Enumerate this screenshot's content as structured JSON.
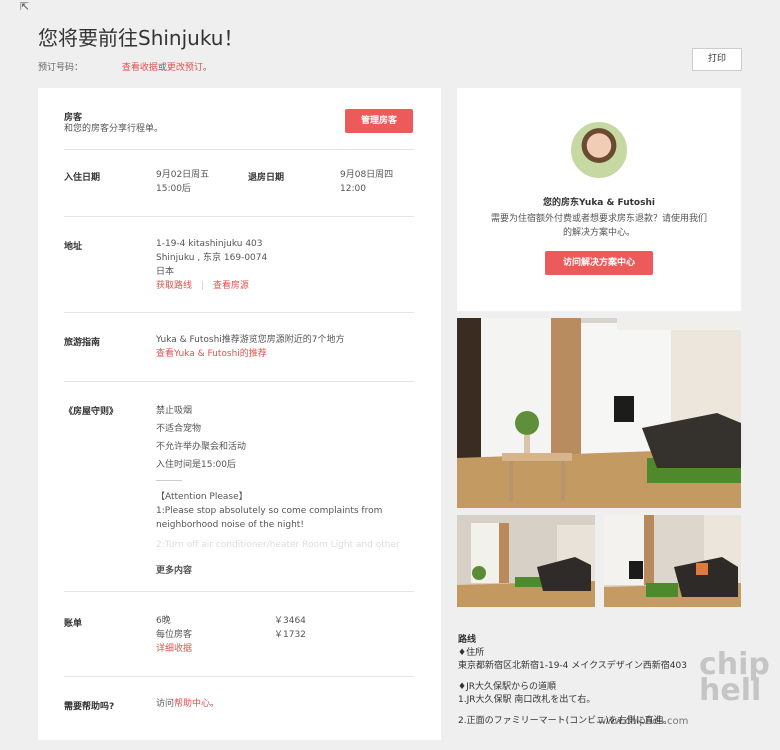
{
  "header": {
    "title": "您将要前往Shinjuku！",
    "booking_code_label": "预订号码：",
    "view_receipt": "查看收据",
    "or": "或",
    "change_booking": "更改预订",
    "period": "。",
    "print": "打印"
  },
  "guests": {
    "label": "房客",
    "desc": "和您的房客分享行程单。",
    "manage_btn": "管理房客"
  },
  "dates": {
    "checkin_label": "入住日期",
    "checkin_date": "9月02日周五",
    "checkin_time": "15:00后",
    "checkout_label": "退房日期",
    "checkout_date": "9月08日周四",
    "checkout_time": "12:00"
  },
  "address": {
    "label": "地址",
    "line1": "1-19-4 kitashinjuku 403",
    "line2": "Shinjuku , 东京 169-0074",
    "line3": "日本",
    "directions": "获取路线",
    "view_listing": "查看房源"
  },
  "guide": {
    "label": "旅游指南",
    "text": "Yuka & Futoshi推荐游览您房源附近的7个地方",
    "link": "查看Yuka & Futoshi的推荐"
  },
  "rules": {
    "label": "《房屋守则》",
    "items": [
      "禁止吸烟",
      "不适合宠物",
      "不允许举办聚会和活动",
      "入住时间是15:00后"
    ],
    "attention_title": "【Attention Please】",
    "attention_1": "1:Please stop absolutely so come complaints from",
    "attention_2": "neighborhood noise of the night!",
    "faded": "2:Turn off air conditioner/heater Room Light and other",
    "more": "更多内容"
  },
  "bill": {
    "label": "账单",
    "nights": "6晚",
    "nights_amount": "￥3464",
    "per_guest": "每位房客",
    "per_guest_amount": "￥1732",
    "details": "详细收据"
  },
  "help": {
    "label": "需要帮助吗?",
    "prefix": "访问",
    "link": "帮助中心",
    "suffix": "。"
  },
  "host": {
    "name": "您的房东Yuka & Futoshi",
    "text1": "需要为住宿额外付费或者想要求房东退款？请使用我们",
    "text2": "的解决方案中心。",
    "btn": "访问解决方案中心"
  },
  "route": {
    "heading": "路线",
    "l1": "♦住所",
    "l2": "東京都新宿区北新宿1-19-4 メイクスデザイン西新宿403",
    "l3": "♦JR大久保駅からの道順",
    "l4": "1.JR大久保駅 南口改札を出て右。",
    "l5": "2.正面のファミリーマート(コンビニ)を右側に直進。"
  },
  "watermark": {
    "site": "www.chiphell.com",
    "logo": "chip\nhell"
  },
  "colors": {
    "accent": "#ed5a5a",
    "link": "#e0524e",
    "bg": "#efefef"
  }
}
